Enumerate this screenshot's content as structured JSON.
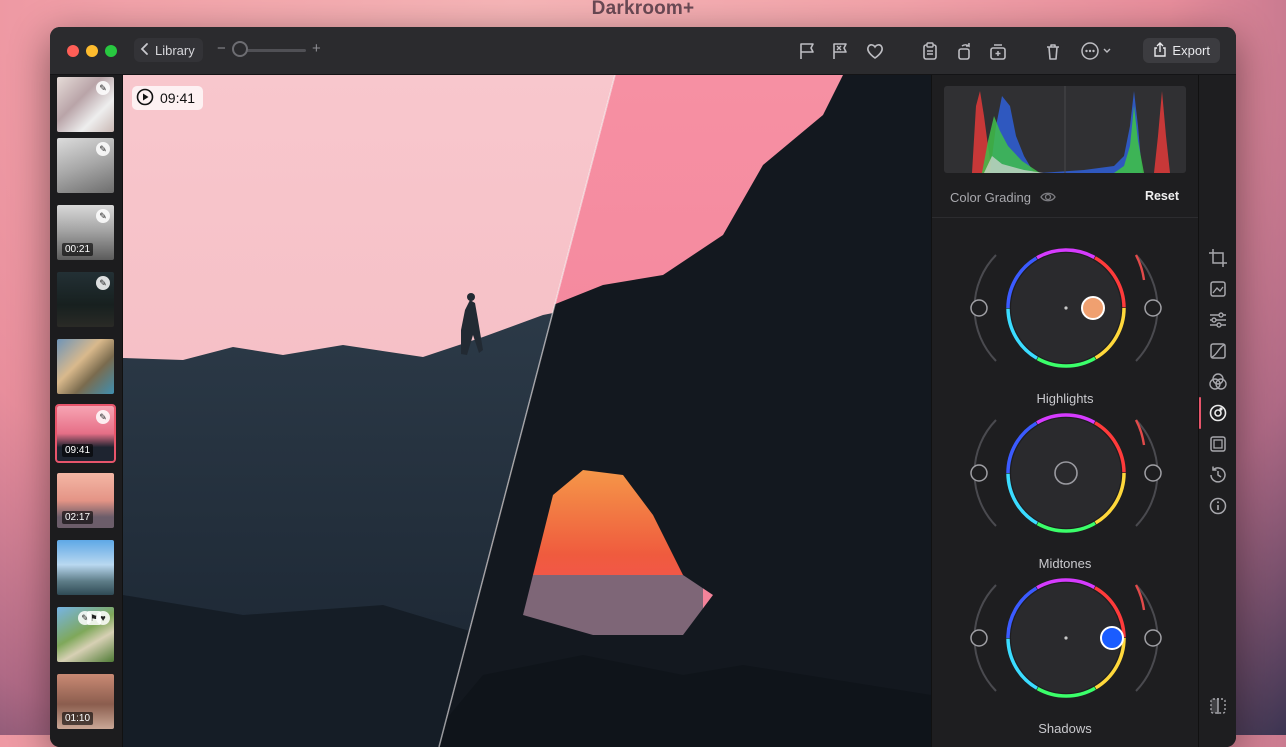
{
  "app": {
    "title": "Darkroom+"
  },
  "toolbar": {
    "library_label": "Library",
    "zoom_minus": "−",
    "zoom_plus": "+",
    "export_label": "Export",
    "icons": [
      "flag-icon",
      "reject-flag-icon",
      "heart-icon",
      "clipboard-icon",
      "rotate-icon",
      "duplicate-icon",
      "trash-icon",
      "more-icon"
    ]
  },
  "filmstrip": {
    "items": [
      {
        "name": "thumb-1",
        "duration": "",
        "edited": true
      },
      {
        "name": "thumb-2",
        "duration": "",
        "edited": true
      },
      {
        "name": "thumb-3",
        "duration": "00:21",
        "edited": true
      },
      {
        "name": "thumb-4",
        "duration": "",
        "edited": true
      },
      {
        "name": "thumb-5",
        "duration": "",
        "edited": false
      },
      {
        "name": "thumb-6",
        "duration": "09:41",
        "edited": true,
        "selected": true
      },
      {
        "name": "thumb-7",
        "duration": "02:17",
        "edited": false
      },
      {
        "name": "thumb-8",
        "duration": "",
        "edited": false
      },
      {
        "name": "thumb-9",
        "duration": "",
        "edited": true
      },
      {
        "name": "thumb-10",
        "duration": "01:10",
        "edited": false
      }
    ]
  },
  "canvas": {
    "time": "09:41"
  },
  "panel": {
    "section_title": "Color Grading",
    "reset_label": "Reset",
    "wheels": [
      {
        "label": "Highlights",
        "knob_color": "#f0a070"
      },
      {
        "label": "Midtones",
        "knob_color": ""
      },
      {
        "label": "Shadows",
        "knob_color": "#1a5cff"
      }
    ]
  },
  "colors": {
    "accent": "#e8556b"
  }
}
